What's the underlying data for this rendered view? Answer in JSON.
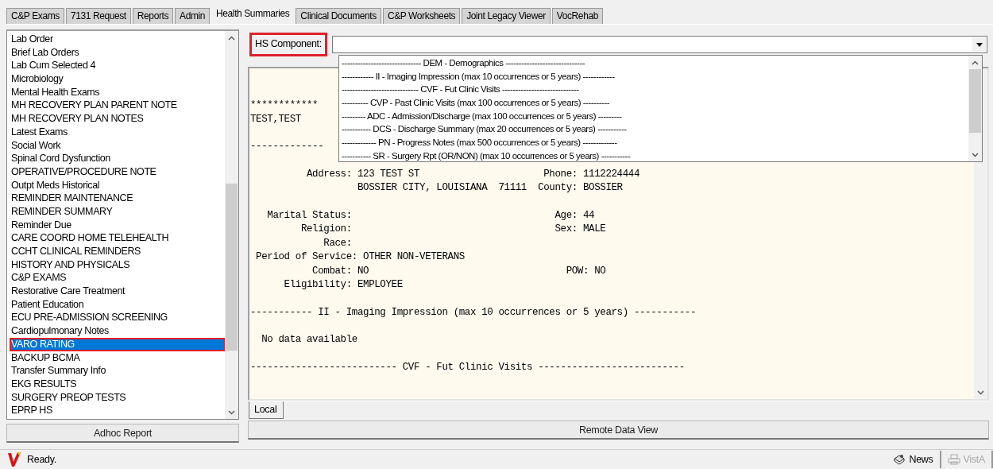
{
  "tabs": [
    {
      "label": "C&P Exams",
      "selected": false
    },
    {
      "label": "7131 Request",
      "selected": false
    },
    {
      "label": "Reports",
      "selected": false
    },
    {
      "label": "Admin",
      "selected": false
    },
    {
      "label": "Health Summaries",
      "selected": true
    },
    {
      "label": "Clinical Documents",
      "selected": false
    },
    {
      "label": "C&P Worksheets",
      "selected": false
    },
    {
      "label": "Joint Legacy Viewer",
      "selected": false
    },
    {
      "label": "VocRehab",
      "selected": false
    }
  ],
  "summary_list": {
    "items": [
      {
        "label": "Lab Order",
        "selected": false
      },
      {
        "label": "Brief Lab Orders",
        "selected": false
      },
      {
        "label": "Lab Cum Selected 4",
        "selected": false
      },
      {
        "label": "Microbiology",
        "selected": false
      },
      {
        "label": "Mental Health Exams",
        "selected": false
      },
      {
        "label": "MH RECOVERY PLAN PARENT NOTE",
        "selected": false
      },
      {
        "label": "MH RECOVERY PLAN NOTES",
        "selected": false
      },
      {
        "label": "Latest Exams",
        "selected": false
      },
      {
        "label": "Social Work",
        "selected": false
      },
      {
        "label": "Spinal Cord Dysfunction",
        "selected": false
      },
      {
        "label": "OPERATIVE/PROCEDURE NOTE",
        "selected": false
      },
      {
        "label": "Outpt Meds Historical",
        "selected": false
      },
      {
        "label": "REMINDER MAINTENANCE",
        "selected": false
      },
      {
        "label": "REMINDER SUMMARY",
        "selected": false
      },
      {
        "label": "Reminder Due",
        "selected": false
      },
      {
        "label": "CARE COORD HOME TELEHEALTH",
        "selected": false
      },
      {
        "label": "CCHT CLINICAL REMINDERS",
        "selected": false
      },
      {
        "label": "HISTORY AND PHYSICALS",
        "selected": false
      },
      {
        "label": "C&P EXAMS",
        "selected": false
      },
      {
        "label": "Restorative Care Treatment",
        "selected": false
      },
      {
        "label": "Patient Education",
        "selected": false
      },
      {
        "label": "ECU PRE-ADMISSION SCREENING",
        "selected": false
      },
      {
        "label": "Cardiopulmonary Notes",
        "selected": false
      },
      {
        "label": "VARO RATING",
        "selected": true
      },
      {
        "label": "BACKUP BCMA",
        "selected": false
      },
      {
        "label": "Transfer Summary Info",
        "selected": false
      },
      {
        "label": "EKG RESULTS",
        "selected": false
      },
      {
        "label": "SURGERY PREOP TESTS",
        "selected": false
      },
      {
        "label": "EPRP HS",
        "selected": false
      }
    ],
    "button": "Adhoc Report"
  },
  "hs_component": {
    "label": "HS Component:",
    "options": [
      "------------------------------ DEM - Demographics ------------------------------",
      "------------ II - Imaging Impression (max 10 occurrences or 5 years) ------------",
      "----------------------------- CVF - Fut Clinic Visits -----------------------------",
      "---------- CVP - Past Clinic Visits (max 100 occurrences or 5 years) ----------",
      "--------- ADC - Admission/Discharge (max 100 occurrences or 5 years) ---------",
      "----------- DCS - Discharge Summary (max 20 occurrences or 5 years) -----------",
      "------------- PN - Progress Notes (max 500 occurrences or 5 years) -------------",
      "----------- SR - Surgery Rpt (OR/NON) (max 10 occurrences or 5 years) -----------"
    ]
  },
  "report": {
    "sections": [
      {
        "lines": [
          "************",
          "TEST,TEST"
        ]
      },
      {
        "lines": [
          "-------------"
        ]
      },
      {
        "lines": [
          "          Address: 123 TEST ST                      Phone: 1112224444",
          "                   BOSSIER CITY, LOUISIANA  71111  County: BOSSIER"
        ]
      },
      {
        "lines": [
          "   Marital Status:                                    Age: 44",
          "         Religion:                                    Sex: MALE",
          "             Race:",
          " Period of Service: OTHER NON-VETERANS",
          "           Combat: NO                                   POW: NO",
          "      Eligibility: EMPLOYEE"
        ]
      },
      {
        "lines": [
          "----------- II - Imaging Impression (max 10 occurrences or 5 years) -----------"
        ]
      },
      {
        "lines": [
          "  No data available"
        ]
      },
      {
        "lines": [
          "-------------------------- CVF - Fut Clinic Visits --------------------------"
        ]
      }
    ]
  },
  "report_tabs": [
    {
      "label": "Local",
      "selected": true
    }
  ],
  "remote_button": "Remote Data View",
  "status_bar": {
    "message": "Ready.",
    "buttons": [
      {
        "kind": "news",
        "label": "News",
        "disabled": false
      },
      {
        "kind": "print",
        "label": "VistA",
        "disabled": true
      }
    ]
  }
}
